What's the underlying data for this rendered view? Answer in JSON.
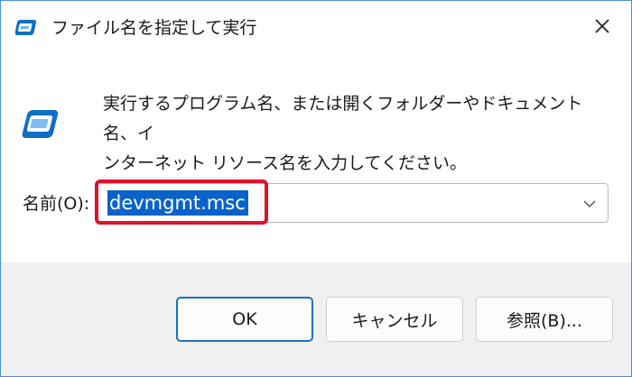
{
  "window": {
    "title": "ファイル名を指定して実行",
    "close_glyph": "✕"
  },
  "content": {
    "description_line1": "実行するプログラム名、または開くフォルダーやドキュメント名、イ",
    "description_line2": "ンターネット リソース名を入力してください。",
    "name_label": "名前(O):",
    "name_value": "devmgmt.msc"
  },
  "buttons": {
    "ok": "OK",
    "cancel": "キャンセル",
    "browse": "参照(B)..."
  },
  "icons": {
    "title": "run-icon",
    "main": "run-icon",
    "dropdown": "chevron-down-icon",
    "close": "close-icon"
  },
  "colors": {
    "accent": "#0a63c9",
    "highlight_box": "#e0112b",
    "window_border": "#4a8fd6",
    "footer_bg": "#f0f0f0"
  }
}
